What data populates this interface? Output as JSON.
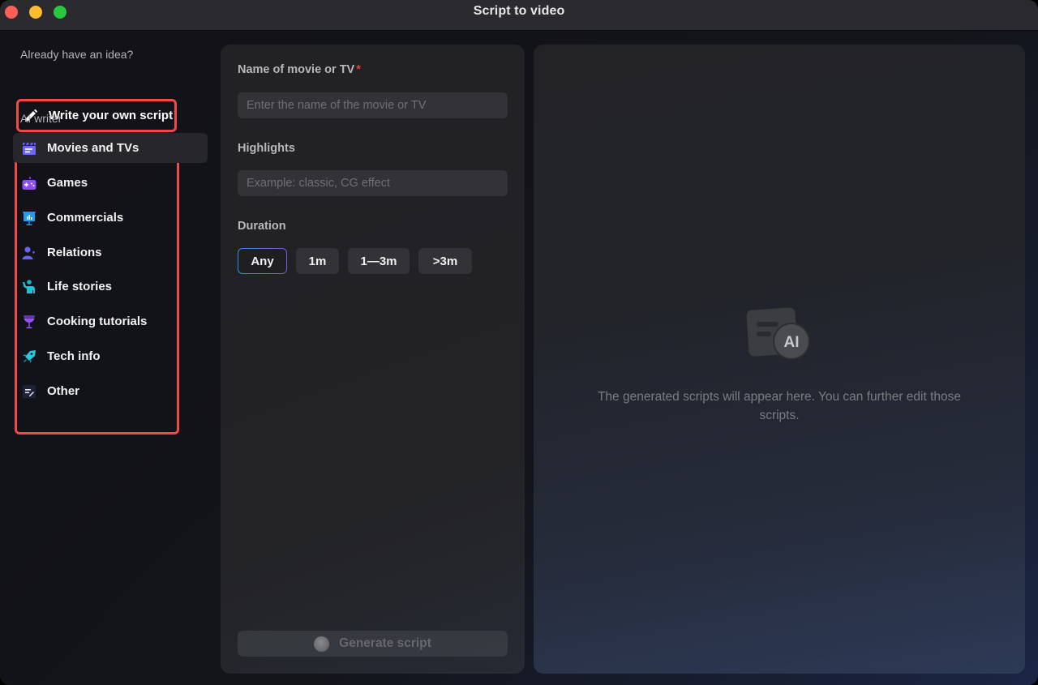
{
  "window": {
    "title": "Script to video",
    "traffic_lights": [
      "close",
      "minimize",
      "maximize"
    ]
  },
  "sidebar": {
    "heading": "Already have an idea?",
    "write_own": {
      "label": "Write your own script",
      "icon": "pencil-icon"
    },
    "ai_writer_label": "AI writer",
    "items": [
      {
        "label": "Movies and TVs",
        "icon": "clapperboard-icon",
        "active": true
      },
      {
        "label": "Games",
        "icon": "gamepad-icon",
        "active": false
      },
      {
        "label": "Commercials",
        "icon": "presentation-icon",
        "active": false
      },
      {
        "label": "Relations",
        "icon": "person-heart-icon",
        "active": false
      },
      {
        "label": "Life stories",
        "icon": "person-waving-icon",
        "active": false
      },
      {
        "label": "Cooking tutorials",
        "icon": "wine-glass-icon",
        "active": false
      },
      {
        "label": "Tech info",
        "icon": "rocket-icon",
        "active": false
      },
      {
        "label": "Other",
        "icon": "note-edit-icon",
        "active": false
      }
    ],
    "highlight_color": "#ef4a4a"
  },
  "form": {
    "name_label": "Name of movie or TV",
    "name_required_mark": "*",
    "name_value": "",
    "name_placeholder": "Enter the name of the movie or TV",
    "highlights_label": "Highlights",
    "highlights_value": "",
    "highlights_placeholder": "Example: classic, CG effect",
    "duration_label": "Duration",
    "duration_options": [
      "Any",
      "1m",
      "1—3m",
      ">3m"
    ],
    "duration_selected": "Any",
    "generate_label": "Generate script"
  },
  "preview": {
    "icon": "ai-script-icon",
    "icon_text": "AI",
    "empty_message": "The generated scripts will appear here. You can further edit those scripts."
  }
}
